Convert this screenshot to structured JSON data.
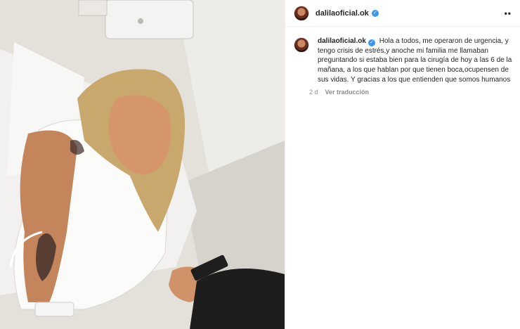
{
  "post": {
    "username": "dalilaoficial.ok",
    "verified_icon": "verified-badge-icon",
    "more_icon": "more-options-icon",
    "more_glyph": "••",
    "caption": "Hola a todos, me operaron de urgencia, y tengo crisis de estrés,y anoche mi familia me llamaban preguntando si estaba bien para la cirugía de hoy a las 6 de la mañana, a los que hablan por que tienen boca,ocupensen de sus vidas. Y gracias a los que entienden que somos humanos",
    "time_ago": "2 d",
    "translate_label": "Ver traducción"
  },
  "colors": {
    "verified_blue": "#3897f0",
    "meta_gray": "#8e8e8e",
    "text": "#262626"
  }
}
